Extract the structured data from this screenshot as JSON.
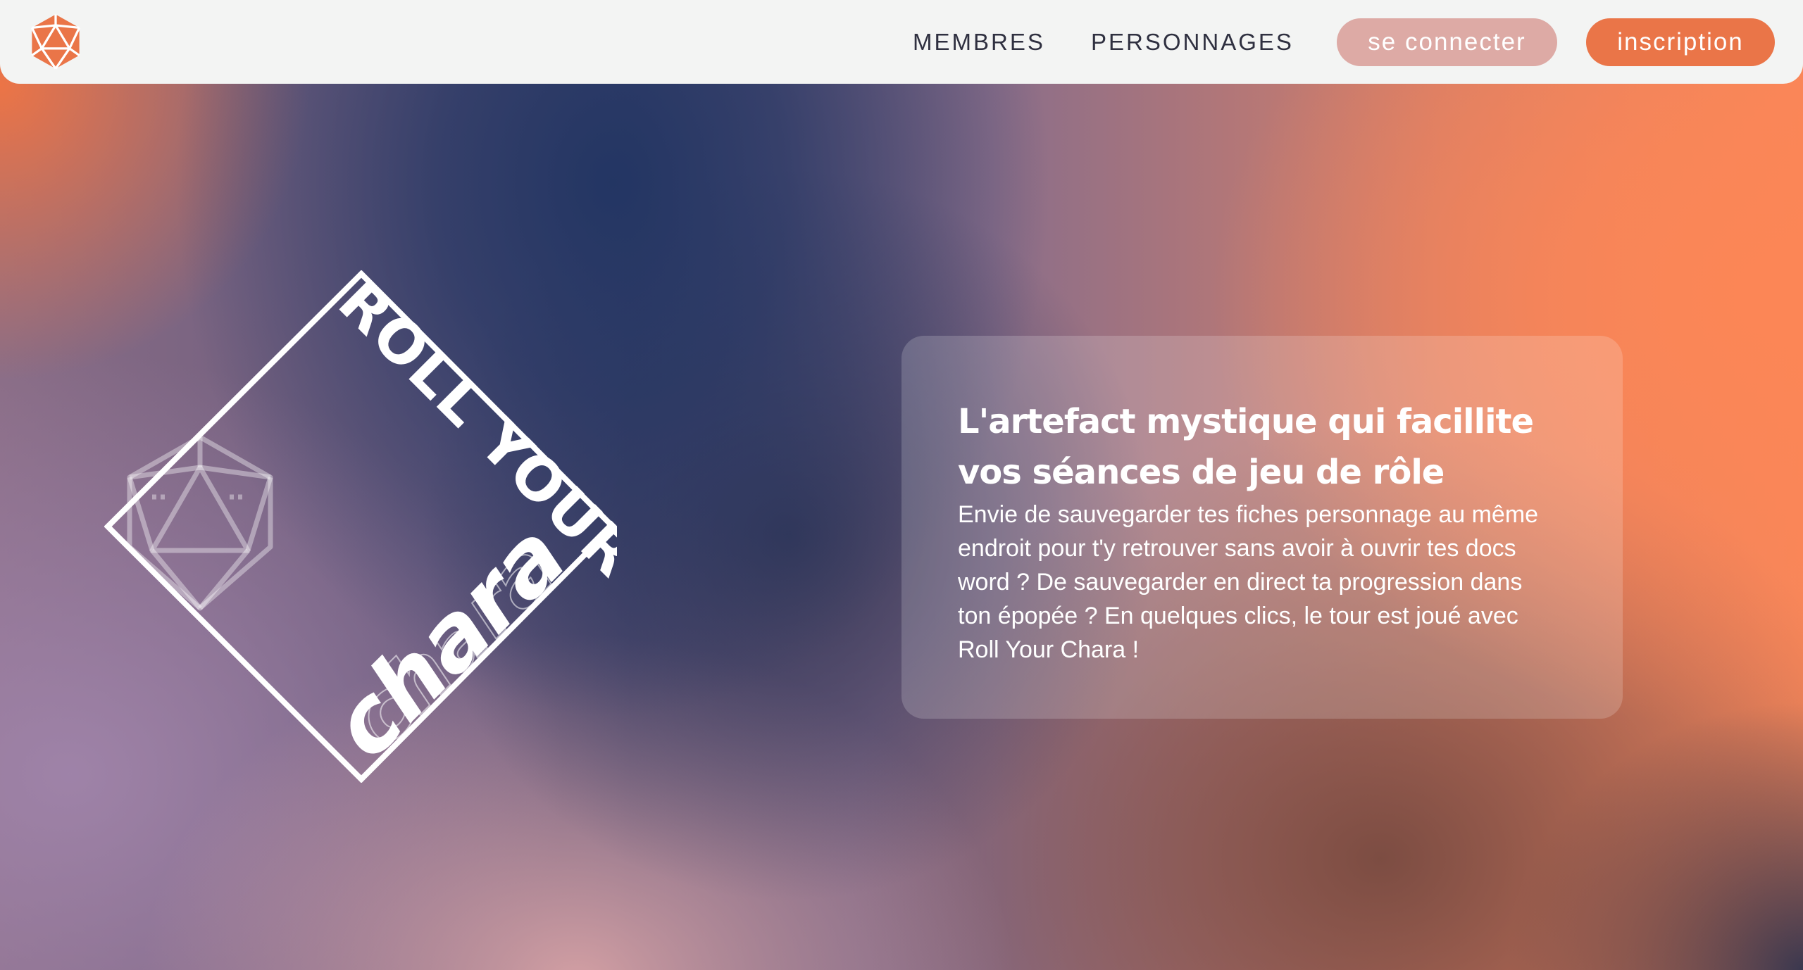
{
  "header": {
    "logo_icon": "d20-dice-icon",
    "nav": {
      "members_label": "MEMBRES",
      "characters_label": "PERSONNAGES"
    },
    "login_label": "se connecter",
    "signup_label": "inscription"
  },
  "hero": {
    "brand": {
      "line1": "ROLL YOUR",
      "line2": "chara",
      "echo": "chara",
      "icon": "d20-dice-icon"
    },
    "card": {
      "title": "L'artefact mystique qui facillite vos séances de jeu de rôle",
      "text": "Envie de sauvegarder tes fiches personnage au même endroit pour t'y retrouver sans avoir à ouvrir tes docs word ? De sauvegarder en direct ta progression dans ton épopée ? En quelques clics, le tour est joué avec Roll Your Chara !"
    }
  },
  "colors": {
    "accent": "#ea7548",
    "login_button": "#ddaaa5",
    "header_bg": "#f3f4f3",
    "nav_text": "#2f3040"
  }
}
